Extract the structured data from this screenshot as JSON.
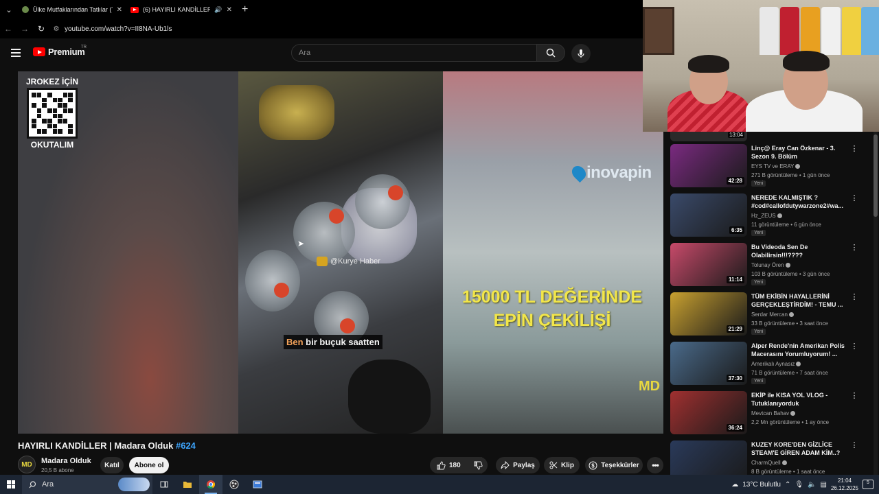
{
  "browser": {
    "tabs": [
      {
        "title": "Ülke Mutfaklarından Tatlılar (Ta",
        "active": false
      },
      {
        "title": "(6) HAYIRLI KANDİLLER | Ma",
        "active": true
      }
    ],
    "url": "youtube.com/watch?v=II8NA-Ub1ls"
  },
  "youtube": {
    "logo_text": "Premium",
    "region": "TR",
    "search_placeholder": "Ara"
  },
  "video": {
    "overlay_top": "JROKEZ İÇİN",
    "overlay_bottom": "OKUTALIM",
    "watermark": "@Kurye Haber",
    "caption_highlight": "Ben",
    "caption_rest": " bir buçuk saatten",
    "brand": "inovapin",
    "promo_line1": "15000 TL DEĞERİNDE",
    "promo_line2": "EPİN ÇEKİLİŞİ",
    "corner_mark": "MD"
  },
  "info": {
    "title": "HAYIRLI KANDİLLER | Madara Olduk",
    "hashtag": "#624",
    "channel": "Madara Olduk",
    "subscribers": "20,5 B abone",
    "avatar_text": "MD",
    "join": "Katıl",
    "subscribe": "Abone ol",
    "likes": "180",
    "share": "Paylaş",
    "clip": "Klip",
    "thanks": "Teşekkürler"
  },
  "sidebar": {
    "partial_duration": "13:04",
    "items": [
      {
        "title": "Linç@ Eray Can Özkenar - 3. Sezon 9. Bölüm",
        "channel": "EYS TV ve ERAY",
        "meta": "271 B görüntüleme • 1 gün önce",
        "badge": "Yeni",
        "duration": "42:28",
        "thumb": "#7a2a80"
      },
      {
        "title": "NEREDE KALMIŞTIK ? #cod#callofdutywarzone2#wa...",
        "channel": "Hz_ZEUS",
        "meta": "11 görüntüleme • 6 gün önce",
        "badge": "Yeni",
        "duration": "6:35",
        "thumb": "#3a4a6a"
      },
      {
        "title": "Bu Videoda Sen De Olabilirsin!!!????",
        "channel": "Tolunay Ören",
        "meta": "103 B görüntüleme • 3 gün önce",
        "badge": "Yeni",
        "duration": "11:14",
        "thumb": "#c84a6a"
      },
      {
        "title": "TÜM EKİBİN HAYALLERİNİ GERÇEKLEŞTİRDİM! - TEMU ...",
        "channel": "Serdar Mercan",
        "meta": "33 B görüntüleme • 3 saat önce",
        "badge": "Yeni",
        "duration": "21:29",
        "thumb": "#c8a030"
      },
      {
        "title": "Alper Rende'nin Amerikan Polis Macerasını Yorumluyorum! ...",
        "channel": "Amerikalı Aynasız",
        "meta": "71 B görüntüleme • 7 saat önce",
        "badge": "Yeni",
        "duration": "37:30",
        "thumb": "#4a6a8a"
      },
      {
        "title": "EKİP ile KISA YOL VLOG - Tutuklanıyorduk",
        "channel": "Mevtcan Bahav",
        "meta": "2,2 Mn görüntüleme • 1 ay önce",
        "badge": "",
        "duration": "36:24",
        "thumb": "#a03030"
      },
      {
        "title": "KUZEY KORE'DEN GİZLİCE STEAM'E GİREN ADAM KİM..?",
        "channel": "CharmQuell",
        "meta": "8 B görüntüleme • 1 saat önce",
        "badge": "",
        "duration": "",
        "thumb": "#2a3a5a"
      }
    ]
  },
  "taskbar": {
    "search": "Ara",
    "weather": "13°C Bulutlu",
    "time": "21:04",
    "date": "26.12.2025",
    "notifications": "5"
  }
}
